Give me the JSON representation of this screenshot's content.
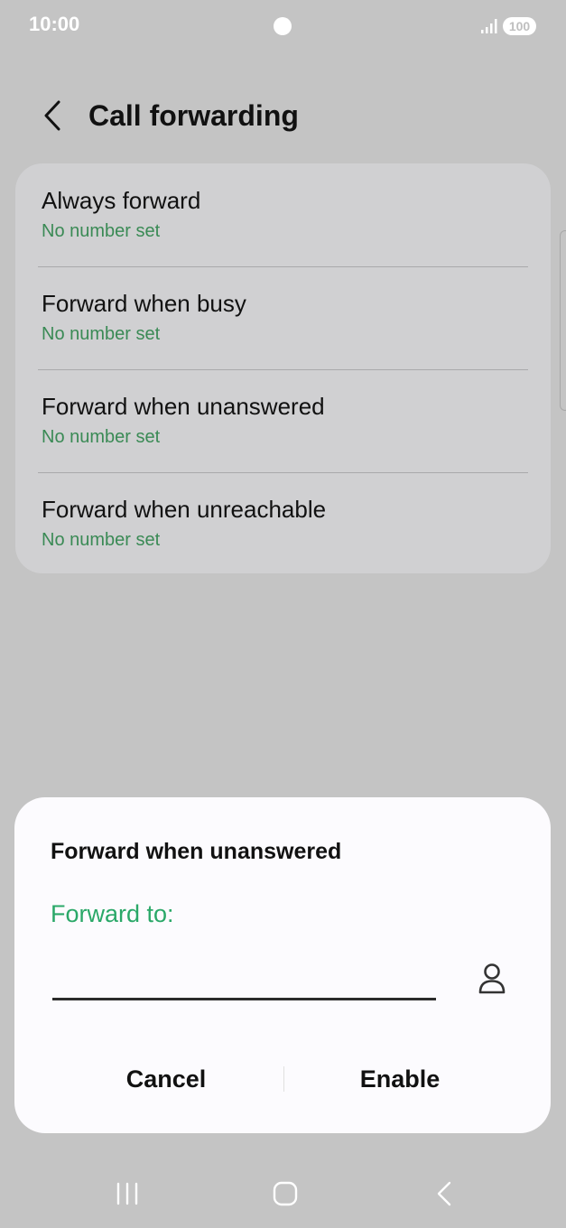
{
  "status_bar": {
    "time": "10:00",
    "battery": "100"
  },
  "header": {
    "title": "Call forwarding"
  },
  "forwarding_options": [
    {
      "title": "Always forward",
      "subtitle": "No number set"
    },
    {
      "title": "Forward when busy",
      "subtitle": "No number set"
    },
    {
      "title": "Forward when unanswered",
      "subtitle": "No number set"
    },
    {
      "title": "Forward when unreachable",
      "subtitle": "No number set"
    }
  ],
  "dialog": {
    "title": "Forward when unanswered",
    "label": "Forward to:",
    "input_value": "",
    "cancel_label": "Cancel",
    "enable_label": "Enable"
  },
  "colors": {
    "accent_green": "#2aa868",
    "subtitle_green": "#3a8a55",
    "backdrop": "#c4c4c4",
    "card": "#d0d0d2",
    "dialog": "#fcfbfe"
  },
  "icons": {
    "back": "chevron-left-icon",
    "contacts": "person-icon",
    "signal": "signal-icon",
    "nav_recents": "recents-icon",
    "nav_home": "home-icon",
    "nav_back": "back-icon"
  }
}
